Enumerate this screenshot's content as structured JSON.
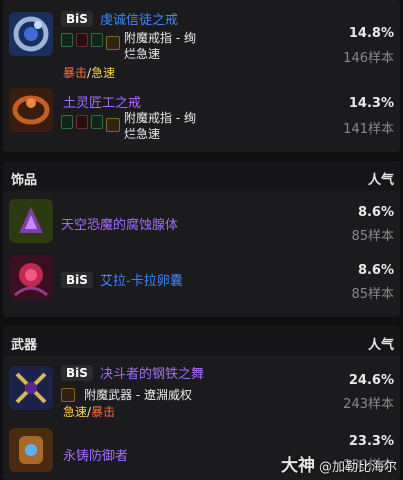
{
  "rings": [
    {
      "bis": "BiS",
      "name": "虔诚信徒之戒",
      "gems": [
        "green",
        "red",
        "green"
      ],
      "enchant": [
        "附魔戒指 - 绚",
        "烂急速"
      ],
      "stats": [
        "暴击",
        "/",
        "急速"
      ],
      "percent": "14.8%",
      "count": "146样本"
    },
    {
      "name": "土灵匠工之戒",
      "gems": [
        "green",
        "red",
        "green"
      ],
      "enchant": [
        "附魔戒指 - 绚",
        "烂急速"
      ],
      "percent": "14.3%",
      "count": "141样本"
    }
  ],
  "trinkets": {
    "title": "饰品",
    "popularity": "人气",
    "items": [
      {
        "name": "天空恐魔的腐蚀腺体",
        "percent": "8.6%",
        "count": "85样本"
      },
      {
        "bis": "BiS",
        "name": "艾拉-卡拉卵囊",
        "percent": "8.6%",
        "count": "85样本"
      }
    ]
  },
  "weapons": {
    "title": "武器",
    "popularity": "人气",
    "items": [
      {
        "bis": "BiS",
        "name": "决斗者的钢铁之舞",
        "enchant": "附魔武器 - 遼淵威权",
        "stats": [
          "急速",
          "/",
          "暴击"
        ],
        "percent": "24.6%",
        "count": "243样本"
      },
      {
        "name": "永铸防御者",
        "percent": "23.3%",
        "count": "230样本"
      }
    ]
  },
  "watermark": {
    "brand": "大神",
    "handle": "@加勒比海尔"
  },
  "colors": {
    "epic_purple": "#a56cff",
    "rare_blue": "#3f86ff",
    "crit": "#ff6a3d",
    "haste": "#ffd44a"
  }
}
